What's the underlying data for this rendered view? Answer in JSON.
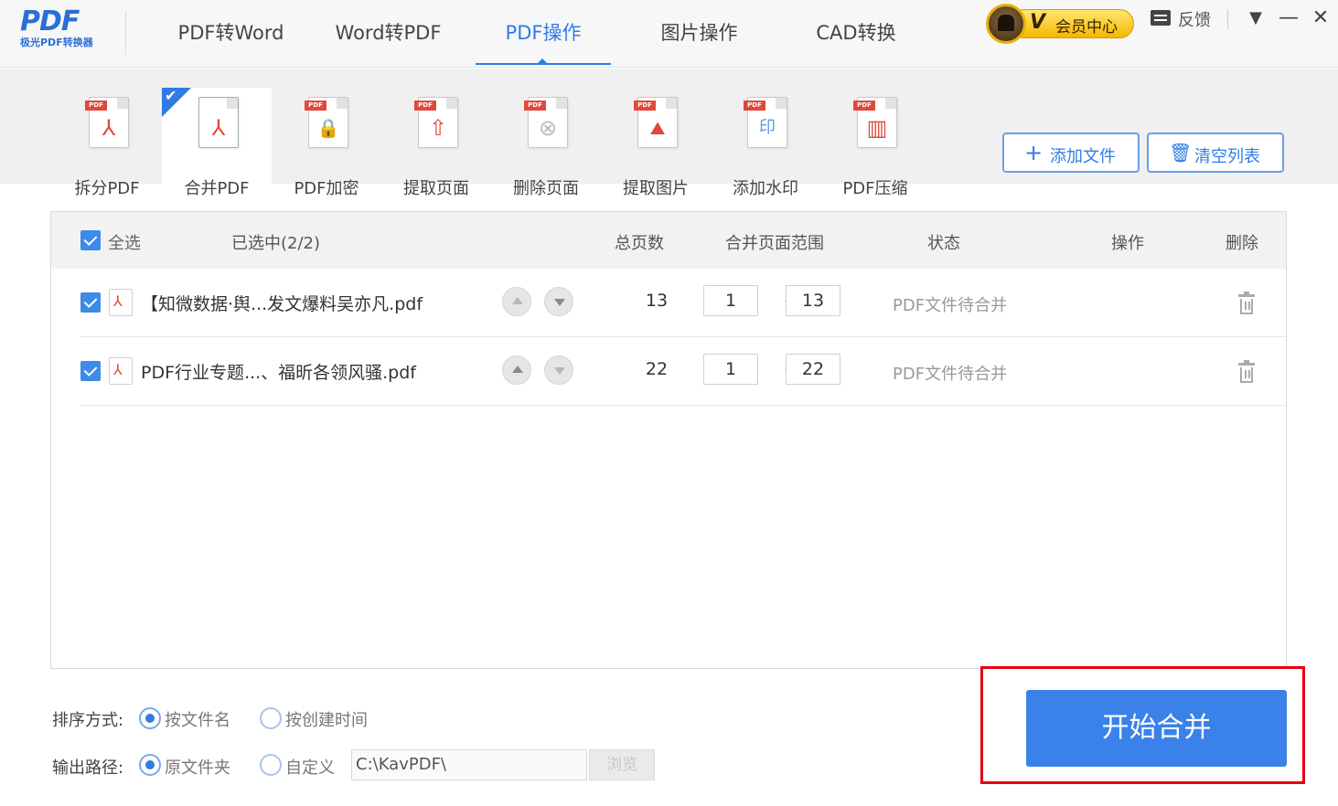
{
  "app": {
    "logo_mark": "PDF",
    "logo_sub": "极光PDF转换器"
  },
  "nav": {
    "tabs": [
      {
        "label": "PDF转Word"
      },
      {
        "label": "Word转PDF"
      },
      {
        "label": "PDF操作"
      },
      {
        "label": "图片操作"
      },
      {
        "label": "CAD转换"
      }
    ],
    "active_index": 2
  },
  "header": {
    "vip_label": "会员中心",
    "vip_badge": "V",
    "feedback_label": "反馈",
    "menu_icon": "▼",
    "minimize_icon": "—",
    "close_icon": "✕"
  },
  "toolbar": {
    "tools": [
      {
        "label": "拆分PDF",
        "icon": "split-pdf-icon",
        "glyph": "⅄"
      },
      {
        "label": "合并PDF",
        "icon": "merge-pdf-icon",
        "glyph": "⅄"
      },
      {
        "label": "PDF加密",
        "icon": "encrypt-pdf-icon",
        "glyph": "🔒"
      },
      {
        "label": "提取页面",
        "icon": "extract-page-icon",
        "glyph": "⇧"
      },
      {
        "label": "删除页面",
        "icon": "delete-page-icon",
        "glyph": "⊗"
      },
      {
        "label": "提取图片",
        "icon": "extract-image-icon",
        "glyph": "⛰"
      },
      {
        "label": "添加水印",
        "icon": "add-watermark-icon",
        "glyph": "印"
      },
      {
        "label": "PDF压缩",
        "icon": "compress-pdf-icon",
        "glyph": "▥"
      }
    ],
    "doc_tag": "PDF",
    "active_index": 1,
    "add_file_label": "添加文件",
    "clear_list_label": "清空列表"
  },
  "list": {
    "headers": {
      "select_all": "全选",
      "selected_count": "已选中(2/2)",
      "total_pages": "总页数",
      "merge_range": "合并页面范围",
      "status": "状态",
      "actions": "操作",
      "delete": "删除"
    },
    "rows": [
      {
        "filename": "【知微数据·舆...发文爆料吴亦凡.pdf",
        "pages": "13",
        "range_from": "1",
        "range_to": "13",
        "status": "PDF文件待合并"
      },
      {
        "filename": "PDF行业专题...、福昕各领风骚.pdf",
        "pages": "22",
        "range_from": "1",
        "range_to": "22",
        "status": "PDF文件待合并"
      }
    ]
  },
  "options": {
    "sort_label": "排序方式:",
    "sort_by_name": "按文件名",
    "sort_by_time": "按创建时间",
    "output_label": "输出路径:",
    "output_original": "原文件夹",
    "output_custom": "自定义",
    "output_path": "C:\\KavPDF\\",
    "browse_label": "浏览"
  },
  "start_button_label": "开始合并",
  "colors": {
    "accent": "#2f7ce6",
    "start_button": "#3a82ea",
    "highlight_border": "#e60012",
    "vip_gold": "#f4b700"
  }
}
